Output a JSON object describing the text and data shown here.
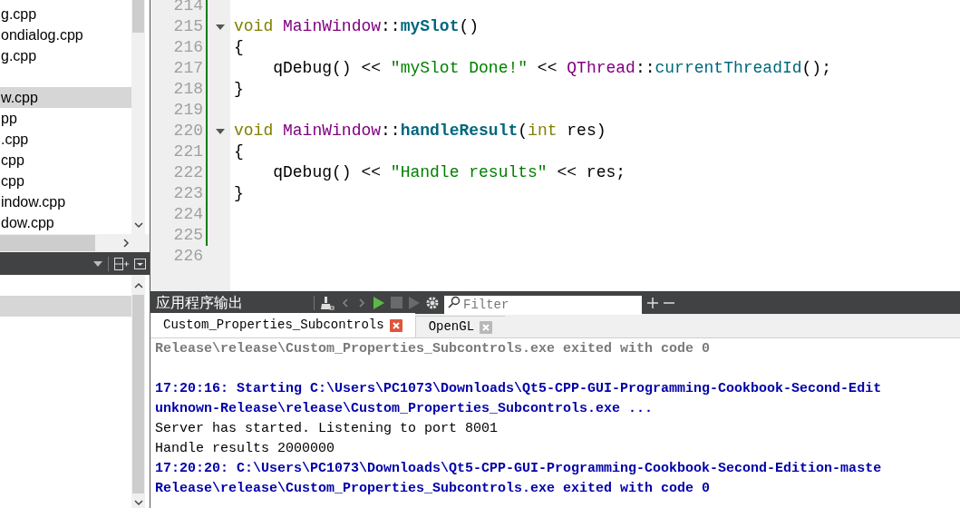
{
  "project_tree": {
    "items": [
      {
        "label": "g.cpp",
        "selected": false
      },
      {
        "label": "ondialog.cpp",
        "selected": false
      },
      {
        "label": "g.cpp",
        "selected": false
      },
      {
        "selected": false
      },
      {
        "label": "w.cpp",
        "selected": true
      },
      {
        "label": "pp",
        "selected": false
      },
      {
        "label": ".cpp",
        "selected": false
      },
      {
        "label": "cpp",
        "selected": false
      },
      {
        "label": "cpp",
        "selected": false
      },
      {
        "label": "indow.cpp",
        "selected": false
      },
      {
        "label": "dow.cpp",
        "selected": false
      }
    ]
  },
  "open_documents": {
    "items": [
      {
        "selected": false
      },
      {
        "selected": true
      }
    ]
  },
  "editor": {
    "lines": [
      {
        "number": "214",
        "fold": false,
        "modified": true
      },
      {
        "number": "215",
        "fold": true,
        "modified": true,
        "tokens": [
          {
            "text": "void ",
            "kind": "keyword"
          },
          {
            "text": "MainWindow",
            "kind": "type"
          },
          {
            "text": "::",
            "kind": "plain"
          },
          {
            "text": "mySlot",
            "kind": "function_def"
          },
          {
            "text": "()",
            "kind": "plain"
          }
        ]
      },
      {
        "number": "216",
        "fold": false,
        "modified": true,
        "tokens": [
          {
            "text": "{",
            "kind": "plain"
          }
        ]
      },
      {
        "number": "217",
        "fold": false,
        "modified": true,
        "tokens": [
          {
            "text": "    qDebug() << ",
            "kind": "plain"
          },
          {
            "text": "\"mySlot Done!\"",
            "kind": "string"
          },
          {
            "text": " << ",
            "kind": "plain"
          },
          {
            "text": "QThread",
            "kind": "type"
          },
          {
            "text": "::",
            "kind": "plain"
          },
          {
            "text": "currentThreadId",
            "kind": "function"
          },
          {
            "text": "();",
            "kind": "plain"
          }
        ]
      },
      {
        "number": "218",
        "fold": false,
        "modified": true,
        "tokens": [
          {
            "text": "}",
            "kind": "plain"
          }
        ]
      },
      {
        "number": "219",
        "fold": false,
        "modified": true
      },
      {
        "number": "220",
        "fold": true,
        "modified": true,
        "tokens": [
          {
            "text": "void ",
            "kind": "keyword"
          },
          {
            "text": "MainWindow",
            "kind": "type"
          },
          {
            "text": "::",
            "kind": "plain"
          },
          {
            "text": "handleResult",
            "kind": "function_def"
          },
          {
            "text": "(",
            "kind": "plain"
          },
          {
            "text": "int",
            "kind": "keyword"
          },
          {
            "text": " res)",
            "kind": "plain"
          }
        ]
      },
      {
        "number": "221",
        "fold": false,
        "modified": true,
        "tokens": [
          {
            "text": "{",
            "kind": "plain"
          }
        ]
      },
      {
        "number": "222",
        "fold": false,
        "modified": true,
        "tokens": [
          {
            "text": "    qDebug() << ",
            "kind": "plain"
          },
          {
            "text": "\"Handle results\"",
            "kind": "string"
          },
          {
            "text": " << res;",
            "kind": "plain"
          }
        ]
      },
      {
        "number": "223",
        "fold": false,
        "modified": true,
        "tokens": [
          {
            "text": "}",
            "kind": "plain"
          }
        ]
      },
      {
        "number": "224",
        "fold": false,
        "modified": true
      },
      {
        "number": "225",
        "fold": false,
        "modified": true
      },
      {
        "number": "226",
        "fold": false,
        "modified": false
      }
    ]
  },
  "output_pane": {
    "title": "应用程序输出",
    "filter": {
      "placeholder": "Filter"
    },
    "tabs": [
      {
        "label": "Custom_Properties_Subcontrols",
        "selected": true
      },
      {
        "label": "OpenGL",
        "selected": false
      }
    ],
    "lines": [
      {
        "text": "Release\\release\\Custom_Properties_Subcontrols.exe exited with code 0",
        "kind": "status"
      },
      {
        "kind": "blank"
      },
      {
        "text": "17:20:16: Starting C:\\Users\\PC1073\\Downloads\\Qt5-CPP-GUI-Programming-Cookbook-Second-Edit",
        "kind": "launch"
      },
      {
        "text": "unknown-Release\\release\\Custom_Properties_Subcontrols.exe ...",
        "kind": "launch"
      },
      {
        "text": "Server has started. Listening to port 8001",
        "kind": "stdout"
      },
      {
        "text": "Handle results 2000000",
        "kind": "stdout"
      },
      {
        "text": "17:20:20: C:\\Users\\PC1073\\Downloads\\Qt5-CPP-GUI-Programming-Cookbook-Second-Edition-maste",
        "kind": "launch"
      },
      {
        "text": "Release\\release\\Custom_Properties_Subcontrols.exe exited with code 0",
        "kind": "launch"
      }
    ]
  }
}
